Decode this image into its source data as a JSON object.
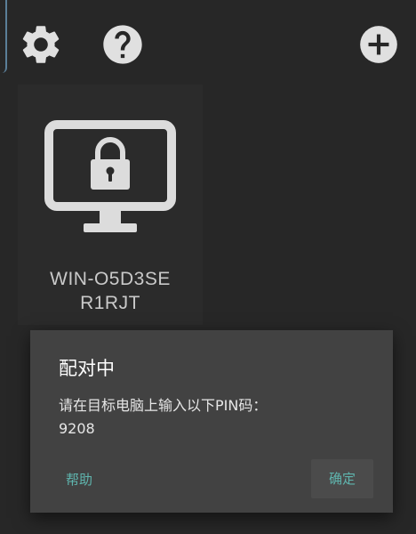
{
  "toolbar": {
    "settings_icon": "gear-icon",
    "help_icon": "question-circle-icon",
    "add_icon": "plus-circle-icon"
  },
  "computer": {
    "icon": "locked-monitor-icon",
    "name_line1": "WIN-O5D3SE",
    "name_line2": "R1RJT"
  },
  "dialog": {
    "title": "配对中",
    "message": "请在目标电脑上输入以下PIN码：",
    "pin": "9208",
    "help_label": "帮助",
    "ok_label": "确定"
  },
  "colors": {
    "background": "#272727",
    "dialog_background": "#424242",
    "accent": "#5fb5ae",
    "icon": "#e0e0e0"
  }
}
